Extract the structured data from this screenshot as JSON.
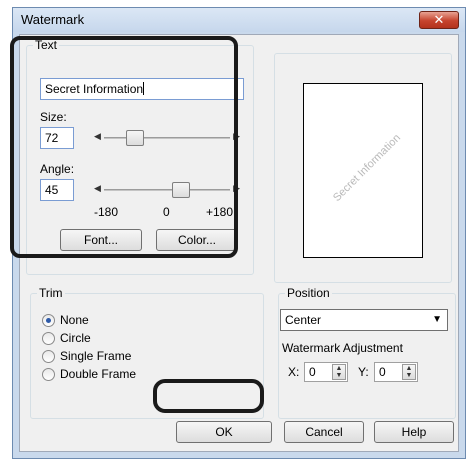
{
  "window": {
    "title": "Watermark",
    "close_glyph": "✕"
  },
  "text_group": {
    "label": "Text",
    "text_value": "Secret Information",
    "size_label": "Size:",
    "size_value": "72",
    "angle_label": "Angle:",
    "angle_value": "45",
    "scale": {
      "min": "-180",
      "mid": "0",
      "max": "+180"
    },
    "size_slider_level": 0.2,
    "angle_slider_level": 0.625,
    "font_button": "Font...",
    "color_button": "Color..."
  },
  "preview": {
    "watermark_text": "Secret Information"
  },
  "trim": {
    "label": "Trim",
    "options": [
      {
        "label": "None",
        "checked": true
      },
      {
        "label": "Circle",
        "checked": false
      },
      {
        "label": "Single Frame",
        "checked": false
      },
      {
        "label": "Double Frame",
        "checked": false
      }
    ]
  },
  "position": {
    "label": "Position",
    "selected": "Center",
    "adjustment_label": "Watermark Adjustment",
    "x_label": "X:",
    "x_value": "0",
    "y_label": "Y:",
    "y_value": "0"
  },
  "buttons": {
    "ok": "OK",
    "cancel": "Cancel",
    "help": "Help"
  },
  "icons": {
    "close": "close-icon",
    "dropdown": "chevron-down-icon",
    "spin_up": "spin-up-icon",
    "spin_down": "spin-down-icon"
  },
  "colors": {
    "title_bar": "#c9d9ec",
    "close_button": "#c6432d",
    "highlight": "#1a1a1a"
  }
}
